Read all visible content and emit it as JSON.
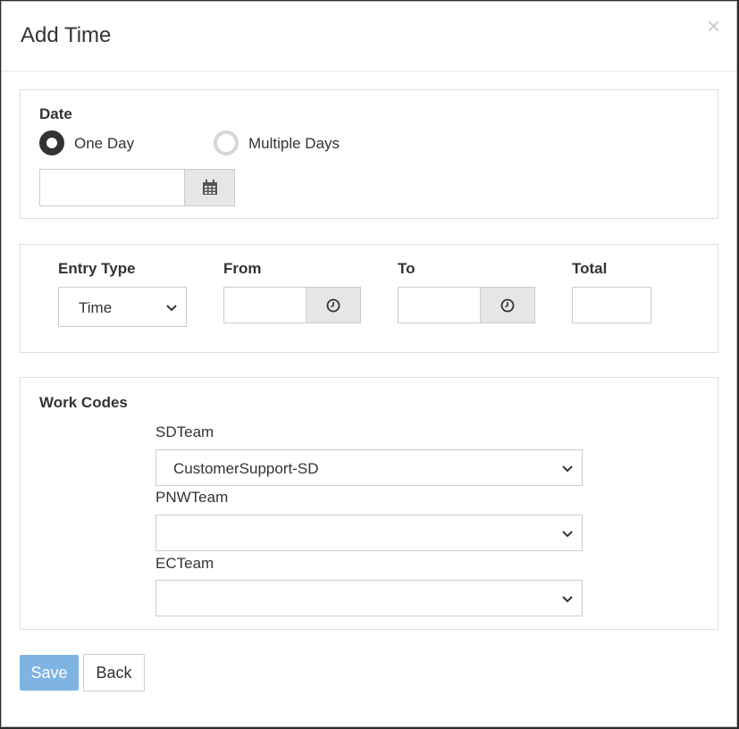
{
  "modal": {
    "title": "Add Time",
    "close_label": "×"
  },
  "date_section": {
    "label": "Date",
    "options": [
      {
        "label": "One Day",
        "checked": true
      },
      {
        "label": "Multiple Days",
        "checked": false
      }
    ],
    "date_value": "",
    "calendar_icon": "calendar-icon"
  },
  "entry_section": {
    "entry_type_label": "Entry Type",
    "entry_type_value": "Time",
    "from_label": "From",
    "from_value": "",
    "to_label": "To",
    "to_value": "",
    "total_label": "Total",
    "total_value": "",
    "clock_icon": "clock-icon"
  },
  "work_codes": {
    "label": "Work Codes",
    "teams": [
      {
        "label": "SDTeam",
        "value": "CustomerSupport-SD"
      },
      {
        "label": "PNWTeam",
        "value": ""
      },
      {
        "label": "ECTeam",
        "value": ""
      }
    ]
  },
  "footer": {
    "save_label": "Save",
    "back_label": "Back",
    "save_color": "#7fb3e2"
  }
}
